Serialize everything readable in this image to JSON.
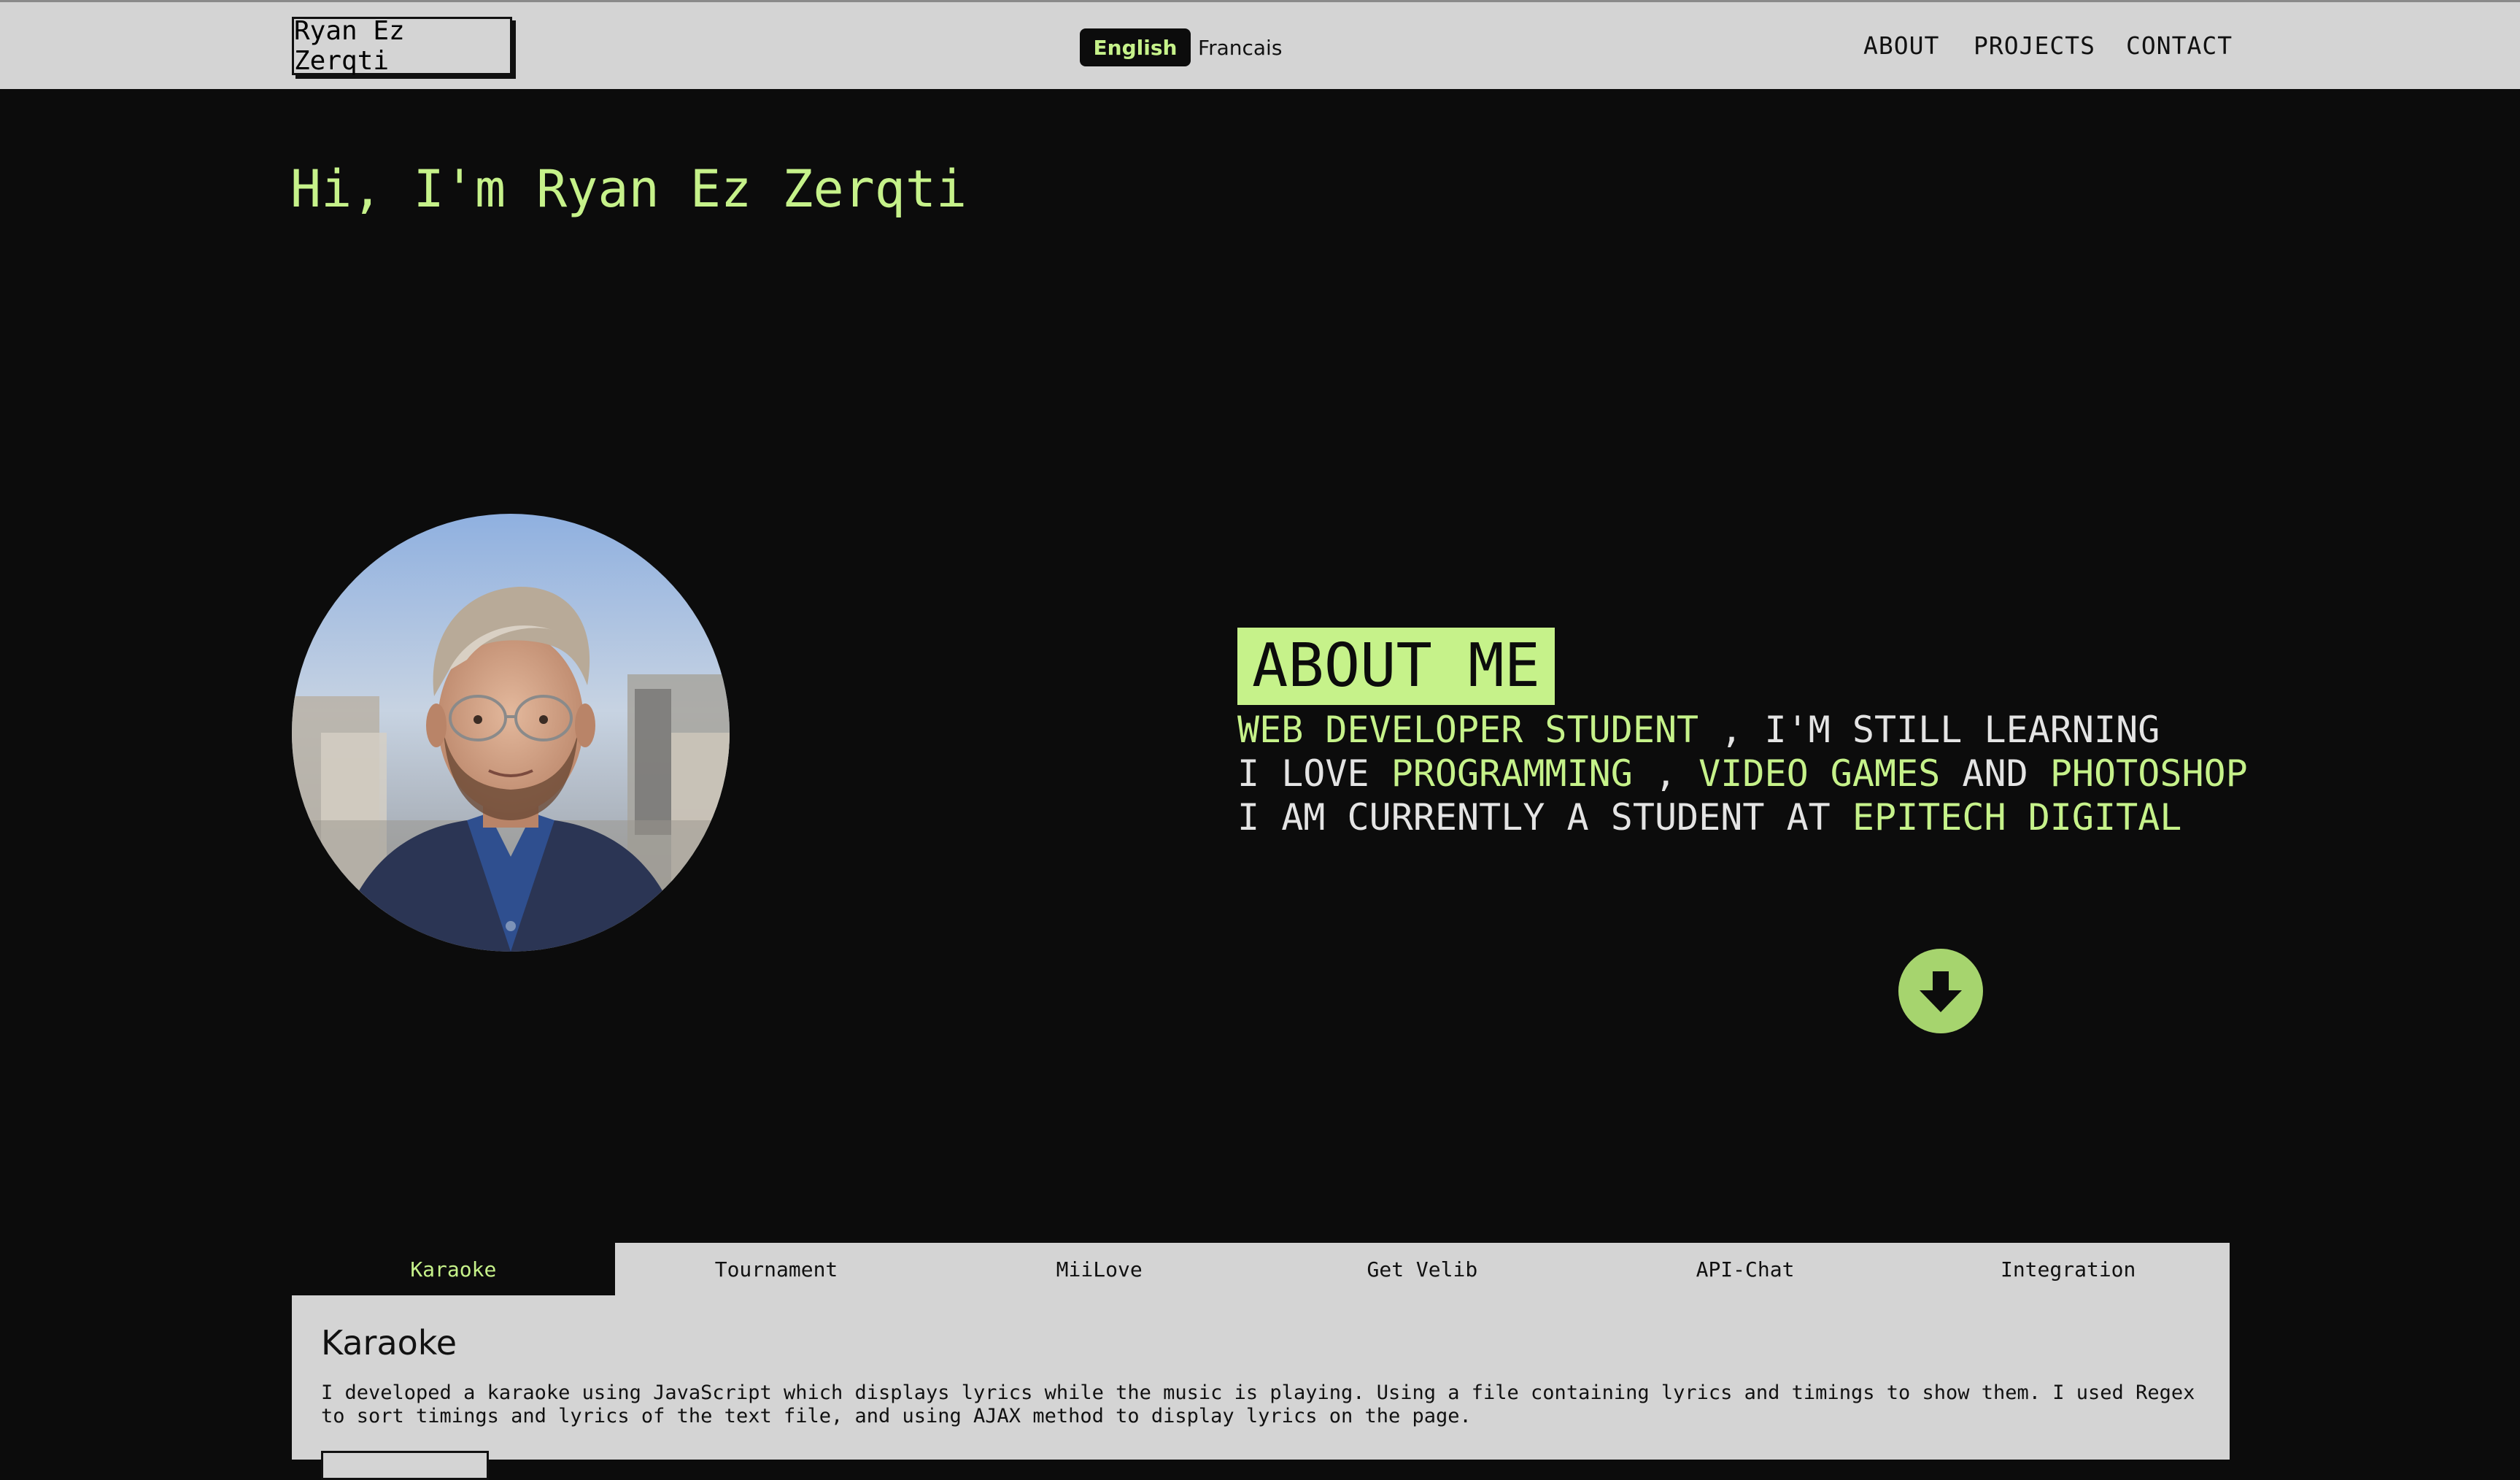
{
  "header": {
    "brand": "Ryan Ez Zerqti",
    "languages": {
      "active": "English",
      "other": "Francais"
    },
    "nav": [
      "ABOUT",
      "PROJECTS",
      "CONTACT"
    ]
  },
  "hero": {
    "title": "Hi, I'm Ryan Ez Zerqti"
  },
  "about": {
    "heading": "ABOUT ME",
    "line1": {
      "hl1": "WEB DEVELOPER STUDENT",
      "t1": " , I'M STILL LEARNING"
    },
    "line2": {
      "t1": "I LOVE ",
      "hl1": "PROGRAMMING",
      "t2": " , ",
      "hl2": "VIDEO GAMES",
      "t3": " AND ",
      "hl3": "PHOTOSHOP"
    },
    "line3": {
      "t1": "I AM CURRENTLY A STUDENT AT ",
      "hl1": "EPITECH DIGITAL"
    }
  },
  "projects": {
    "tabs": [
      "Karaoke",
      "Tournament",
      "MiiLove",
      "Get Velib",
      "API-Chat",
      "Integration"
    ],
    "active_tab": "Karaoke",
    "panel": {
      "title": "Karaoke",
      "description": "I developed a karaoke using JavaScript which displays lyrics while the music is playing. Using a file containing lyrics and timings to show them. I used Regex to sort timings and lyrics of the text file, and using AJAX method to display lyrics on the page."
    }
  },
  "icons": {
    "scroll_down": "arrow-down-icon",
    "avatar": "profile-photo"
  },
  "colors": {
    "accent": "#c6f28a",
    "background": "#0c0c0c",
    "header": "#d4d4d4",
    "scroll_button": "#a6d46e"
  }
}
